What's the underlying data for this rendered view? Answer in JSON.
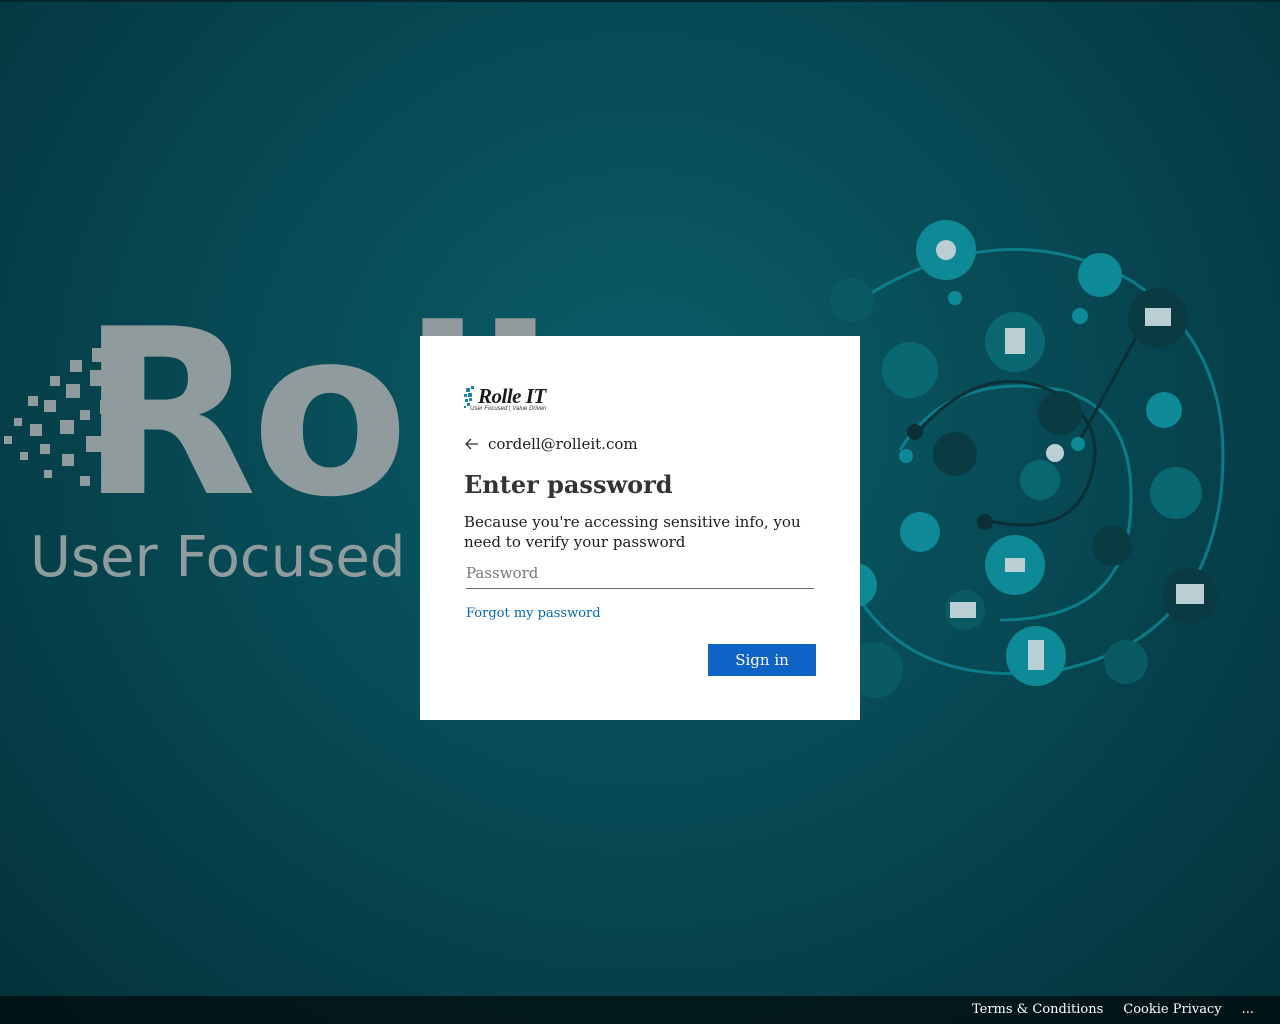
{
  "background": {
    "logo_text": "Roll",
    "logo_tagline": "User Focused | V"
  },
  "brand": {
    "name": "Rolle IT",
    "tagline": "User Focused | Value Driven"
  },
  "signin": {
    "identity_email": "cordell@rolleit.com",
    "title": "Enter password",
    "description": "Because you're accessing sensitive info, you need to verify your password",
    "password_placeholder": "Password",
    "forgot_link": "Forgot my password",
    "submit_label": "Sign in"
  },
  "footer": {
    "terms": "Terms & Conditions",
    "privacy": "Cookie Privacy",
    "more": "..."
  },
  "colors": {
    "accent": "#0f63c6",
    "link": "#0067b8",
    "background": "#074a55"
  },
  "icons": [
    "back-arrow-icon",
    "brand-logo-icon"
  ]
}
